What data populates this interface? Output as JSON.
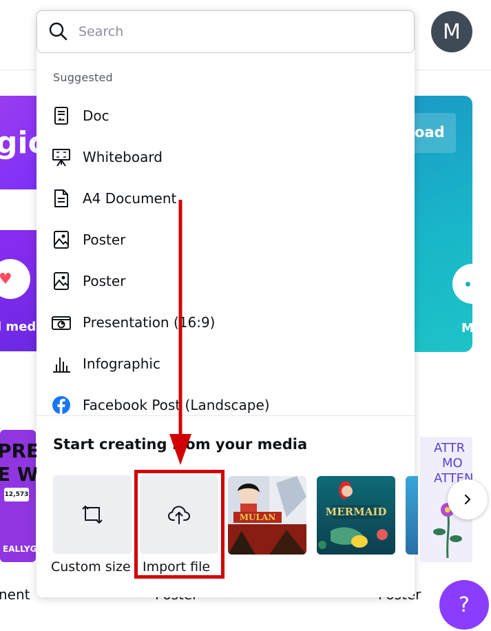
{
  "header": {
    "avatar_initial": "M"
  },
  "search": {
    "placeholder": "Search"
  },
  "suggested": {
    "heading": "Suggested",
    "items": [
      {
        "label": "Doc",
        "icon": "doc-icon"
      },
      {
        "label": "Whiteboard",
        "icon": "whiteboard-icon"
      },
      {
        "label": "A4 Document",
        "icon": "document-icon"
      },
      {
        "label": "Poster",
        "icon": "poster-icon"
      },
      {
        "label": "Poster",
        "icon": "poster-icon"
      },
      {
        "label": "Presentation (16:9)",
        "icon": "presentation-icon"
      },
      {
        "label": "Infographic",
        "icon": "infographic-icon"
      },
      {
        "label": "Facebook Post (Landscape)",
        "icon": "facebook-icon"
      }
    ]
  },
  "media": {
    "heading": "Start creating from your media",
    "custom_size_label": "Custom size",
    "import_file_label": "Import file",
    "thumb1_text": "MULAN",
    "thumb2_text": "MERMAID"
  },
  "background": {
    "magic_text": "gic",
    "upload_text": "oad",
    "social_text": "l medi",
    "right_card_text": "M",
    "left_poster_line1": "PREAD",
    "left_poster_line2": "E WOR",
    "left_poster_chip": "12,573",
    "left_poster_footer": "EALLYGREATS",
    "right_poster_text_1": "ATTR",
    "right_poster_text_2": "MO",
    "right_poster_text_3": "ATTEN",
    "bottom_label_left": "nent",
    "bottom_label_mid": "Poster",
    "bottom_label_right": "Poster"
  },
  "help": {
    "label": "?"
  },
  "colors": {
    "accent_purple": "#8b3dff",
    "highlight_red": "#d10000",
    "teal": "#19b7c9"
  }
}
